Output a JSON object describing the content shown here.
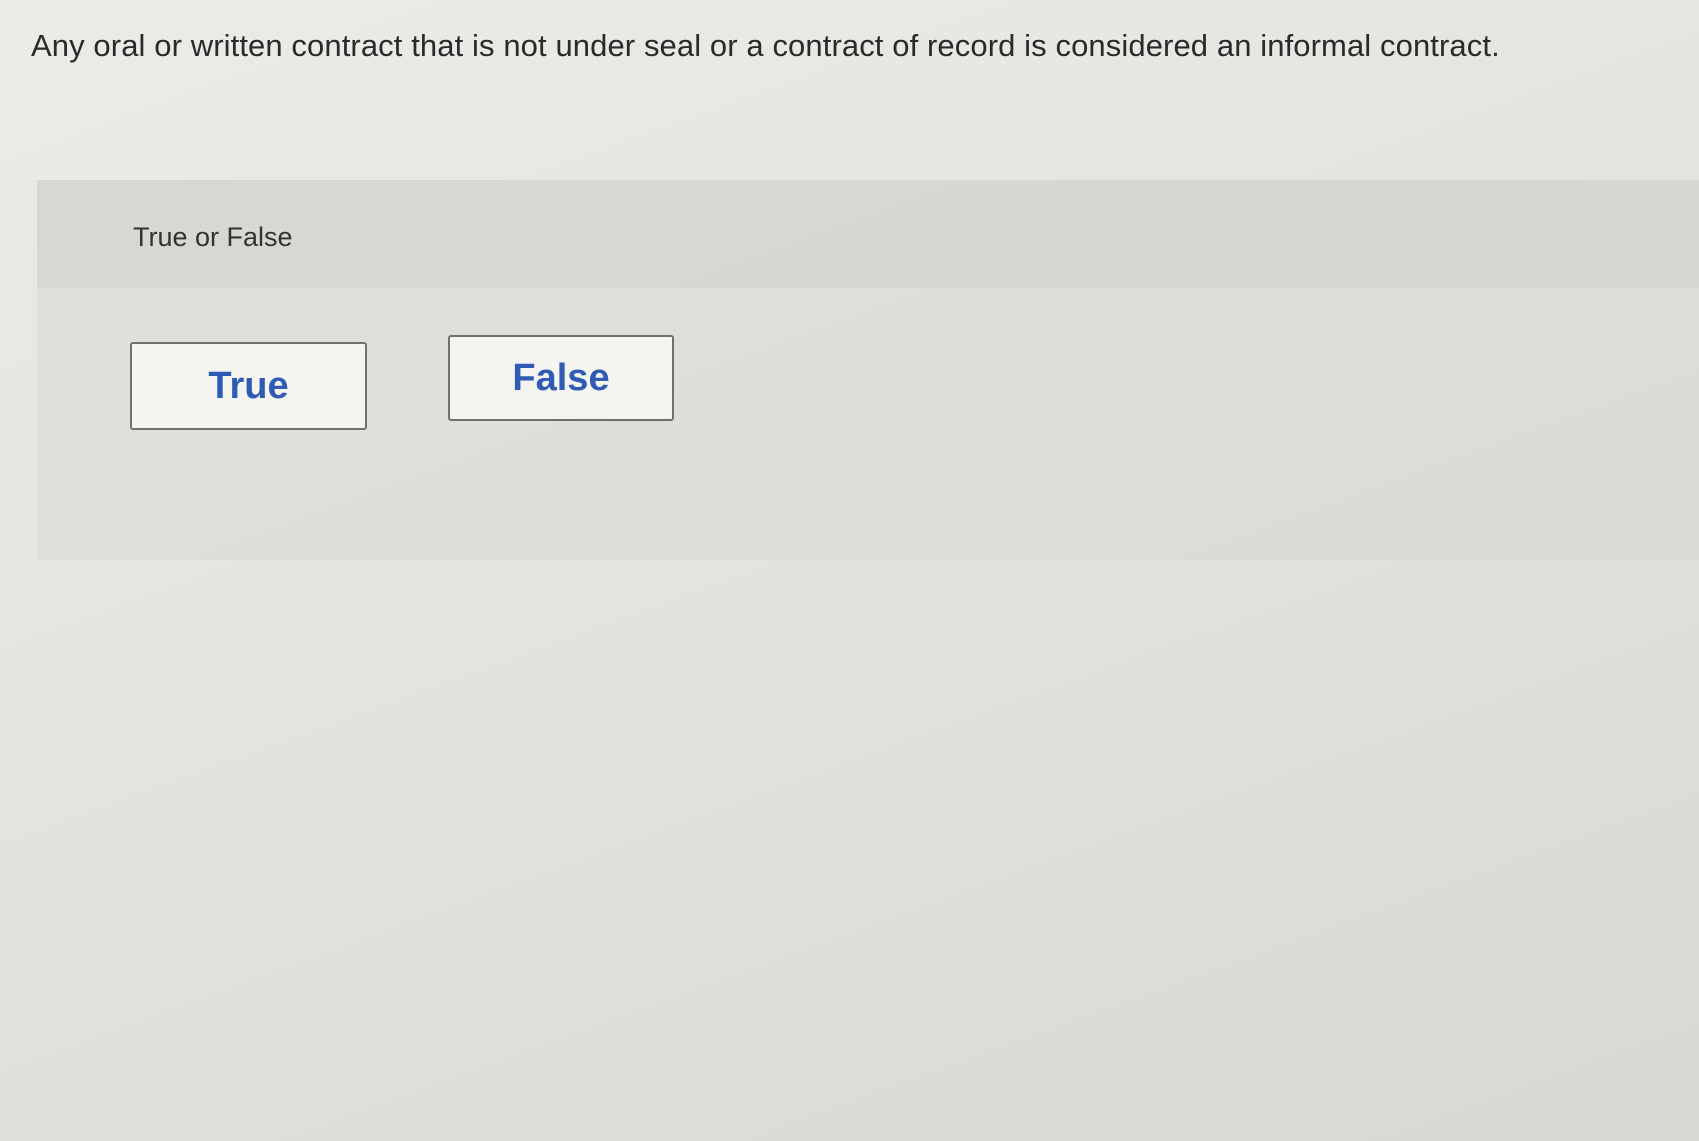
{
  "question": {
    "text": "Any oral or written contract that is not under seal or a contract of record is considered an informal contract."
  },
  "answer_panel": {
    "prompt": "True or False",
    "choices": [
      {
        "label": "True"
      },
      {
        "label": "False"
      }
    ]
  },
  "colors": {
    "choice_text": "#2f5bb5",
    "choice_border": "#6f7170",
    "background": "#e3e4df"
  }
}
